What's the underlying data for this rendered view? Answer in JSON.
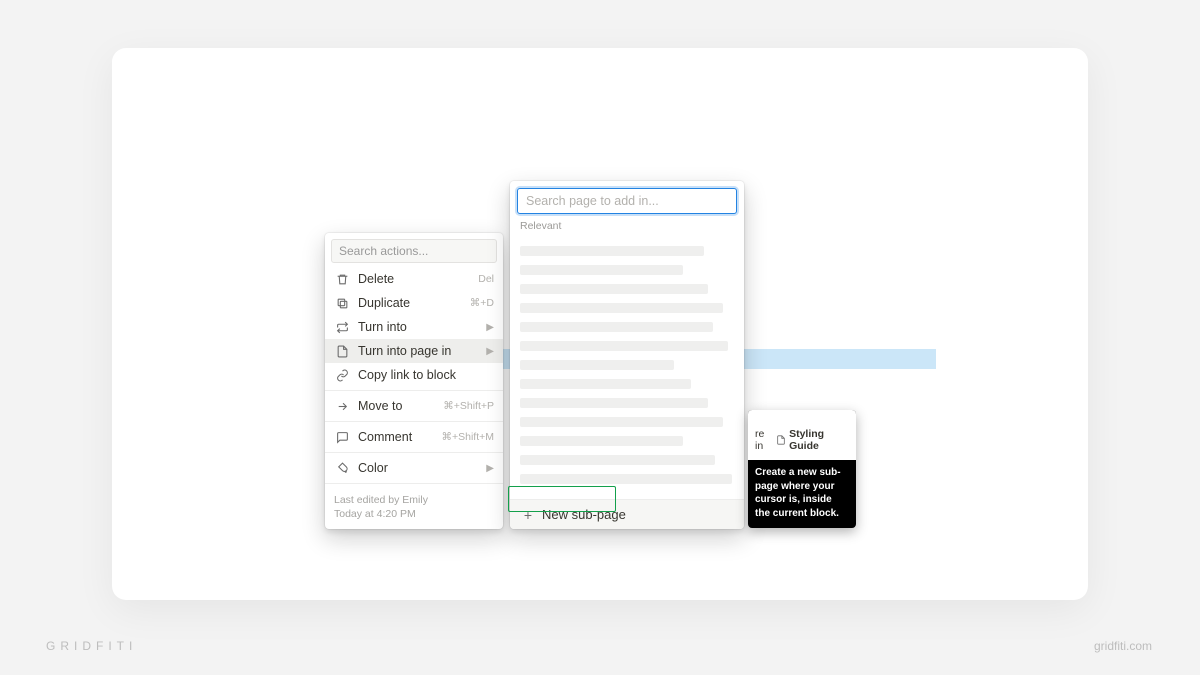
{
  "watermark": {
    "left": "GRIDFITI",
    "right": "gridfiti.com"
  },
  "actions_menu": {
    "search_placeholder": "Search actions...",
    "items": {
      "delete": {
        "label": "Delete",
        "shortcut": "Del"
      },
      "duplicate": {
        "label": "Duplicate",
        "shortcut": "⌘+D"
      },
      "turn_into": {
        "label": "Turn into"
      },
      "turn_into_page_in": {
        "label": "Turn into page in"
      },
      "copy_link": {
        "label": "Copy link to block"
      },
      "move_to": {
        "label": "Move to",
        "shortcut": "⌘+Shift+P"
      },
      "comment": {
        "label": "Comment",
        "shortcut": "⌘+Shift+M"
      },
      "color": {
        "label": "Color"
      }
    },
    "footer": {
      "line1": "Last edited by Emily",
      "line2": "Today at 4:20 PM"
    }
  },
  "page_popover": {
    "search_placeholder": "Search page to add in...",
    "relevant_label": "Relevant",
    "new_subpage_label": "New sub-page"
  },
  "tooltip": {
    "top_prefix": "re in",
    "top_page": "Styling Guide",
    "body": "Create a new sub-page where your cursor is, inside the current block."
  }
}
